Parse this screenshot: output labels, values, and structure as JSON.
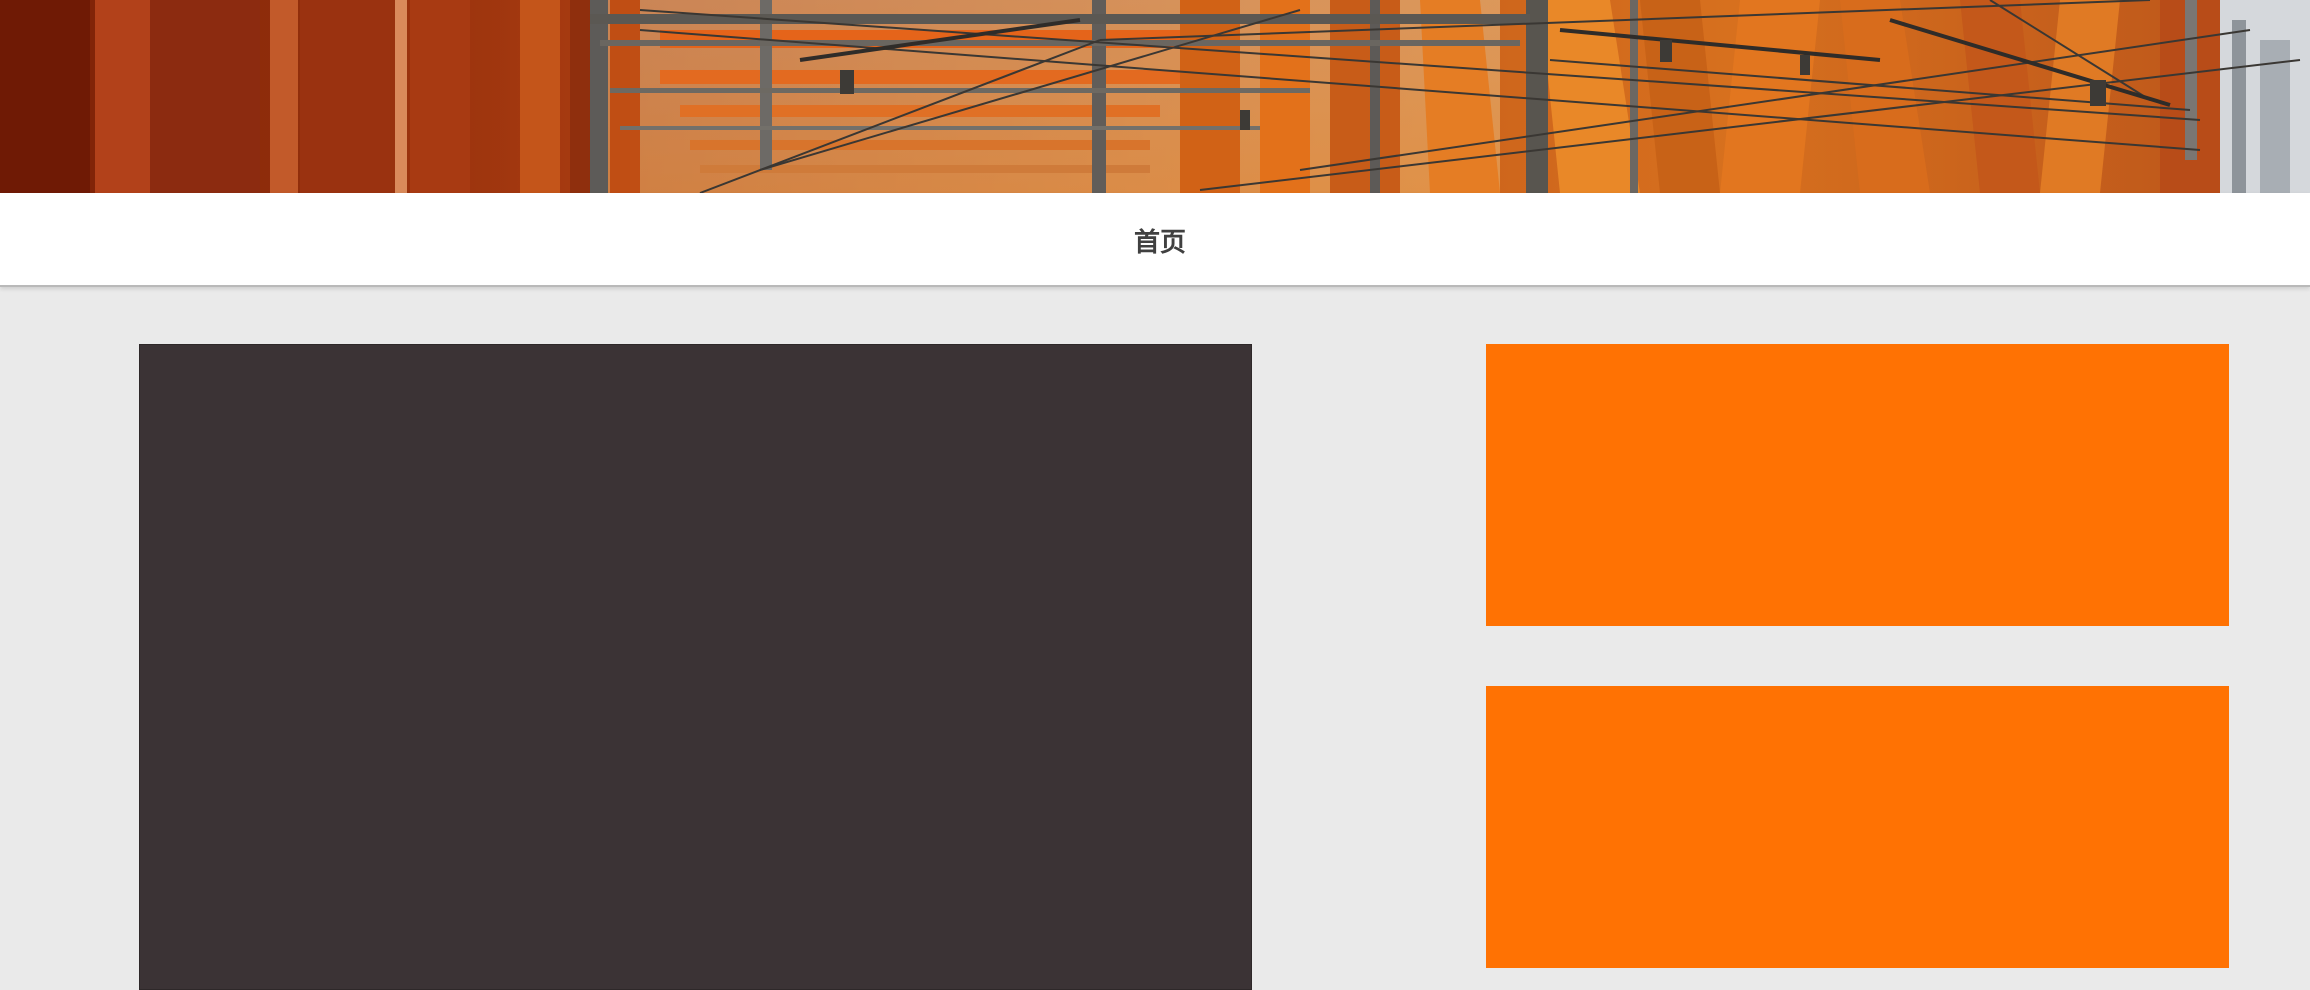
{
  "nav": {
    "home_label": "首页"
  },
  "colors": {
    "page_background": "#eaeaea",
    "nav_background": "#ffffff",
    "main_panel": "#3b3335",
    "side_cards": "#ff7203",
    "banner_dominant": "#c84a12"
  },
  "banner": {
    "image": "banner-photo"
  }
}
